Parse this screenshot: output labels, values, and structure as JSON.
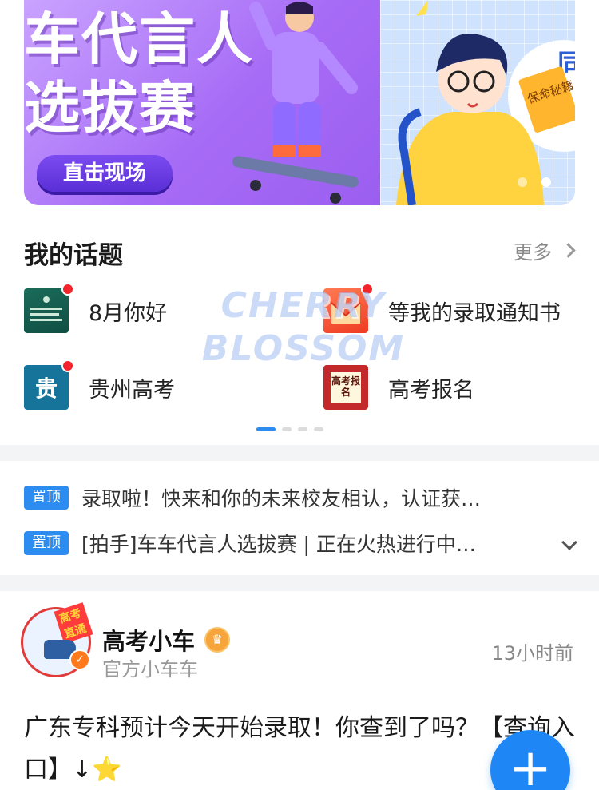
{
  "banner": {
    "slide1": {
      "line1": "车代言人",
      "line2": "选拔赛",
      "cta": "直击现场"
    },
    "slide2": {
      "book_text": "保命秘籍"
    }
  },
  "topics": {
    "title": "我的话题",
    "more": "更多",
    "items": [
      {
        "label": "8月你好",
        "icon": "august-topic-icon"
      },
      {
        "label": "等我的录取通知书",
        "icon": "admission-letter-icon"
      },
      {
        "label": "贵州高考",
        "icon": "guizhou-icon",
        "glyph": "贵"
      },
      {
        "label": "高考报名",
        "icon": "exam-signup-icon",
        "glyph": "高考报名"
      }
    ]
  },
  "pinned": {
    "tag": "置顶",
    "items": [
      {
        "text": "录取啦！快来和你的未来校友相认，认证获…"
      },
      {
        "text": "[拍手]车车代言人选拔赛 | 正在火热进行中…"
      }
    ]
  },
  "post": {
    "author": "高考小车",
    "subtitle": "官方小车车",
    "time": "13小时前",
    "avatar_text": "高考直通",
    "body": "广东专科预计今天开始录取！你查到了吗？【查询入口】↓",
    "body_star": "⭐"
  },
  "watermark": {
    "line1": "CHERRY",
    "line2": "BLOSSOM"
  },
  "colors": {
    "accent": "#2d8cf0",
    "red_dot": "#f3242b",
    "fab": "#1f87f5"
  }
}
